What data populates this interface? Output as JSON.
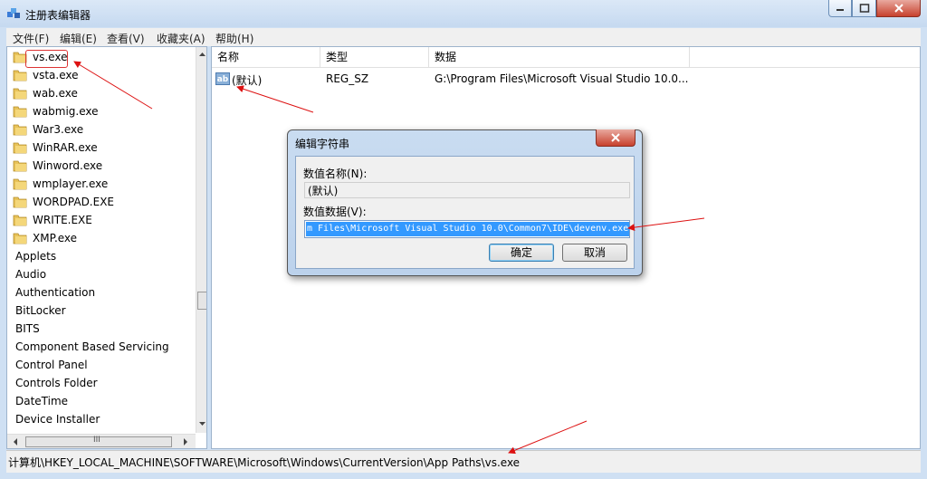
{
  "window": {
    "title": "注册表编辑器"
  },
  "menu": [
    {
      "label": "文件(F)"
    },
    {
      "label": "编辑(E)"
    },
    {
      "label": "查看(V)"
    },
    {
      "label": "收藏夹(A)"
    },
    {
      "label": "帮助(H)"
    }
  ],
  "tree": {
    "items": [
      {
        "label": "vs.exe",
        "folder": true
      },
      {
        "label": "vsta.exe",
        "folder": true
      },
      {
        "label": "wab.exe",
        "folder": true
      },
      {
        "label": "wabmig.exe",
        "folder": true
      },
      {
        "label": "War3.exe",
        "folder": true
      },
      {
        "label": "WinRAR.exe",
        "folder": true
      },
      {
        "label": "Winword.exe",
        "folder": true
      },
      {
        "label": "wmplayer.exe",
        "folder": true
      },
      {
        "label": "WORDPAD.EXE",
        "folder": true
      },
      {
        "label": "WRITE.EXE",
        "folder": true
      },
      {
        "label": "XMP.exe",
        "folder": true
      },
      {
        "label": "Applets",
        "folder": false
      },
      {
        "label": "Audio",
        "folder": false
      },
      {
        "label": "Authentication",
        "folder": false
      },
      {
        "label": "BitLocker",
        "folder": false
      },
      {
        "label": "BITS",
        "folder": false
      },
      {
        "label": "Component Based Servicing",
        "folder": false
      },
      {
        "label": "Control Panel",
        "folder": false
      },
      {
        "label": "Controls Folder",
        "folder": false
      },
      {
        "label": "DateTime",
        "folder": false
      },
      {
        "label": "Device Installer",
        "folder": false
      }
    ],
    "hscroll_glyph": "III"
  },
  "list": {
    "columns": [
      "名称",
      "类型",
      "数据"
    ],
    "rows": [
      {
        "name": "(默认)",
        "type": "REG_SZ",
        "data": "G:\\Program Files\\Microsoft Visual Studio 10.0...",
        "icon": "ab"
      }
    ]
  },
  "status": {
    "path": "计算机\\HKEY_LOCAL_MACHINE\\SOFTWARE\\Microsoft\\Windows\\CurrentVersion\\App Paths\\vs.exe"
  },
  "dialog": {
    "title": "编辑字符串",
    "name_label": "数值名称(N):",
    "name_value": "(默认)",
    "data_label": "数值数据(V):",
    "data_value": "m Files\\Microsoft Visual Studio 10.0\\Common7\\IDE\\devenv.exe",
    "ok_label": "确定",
    "cancel_label": "取消"
  },
  "colors": {
    "annotation": "#dd1111",
    "selection": "#3399ff",
    "window_frame": "#cfe0f3"
  }
}
